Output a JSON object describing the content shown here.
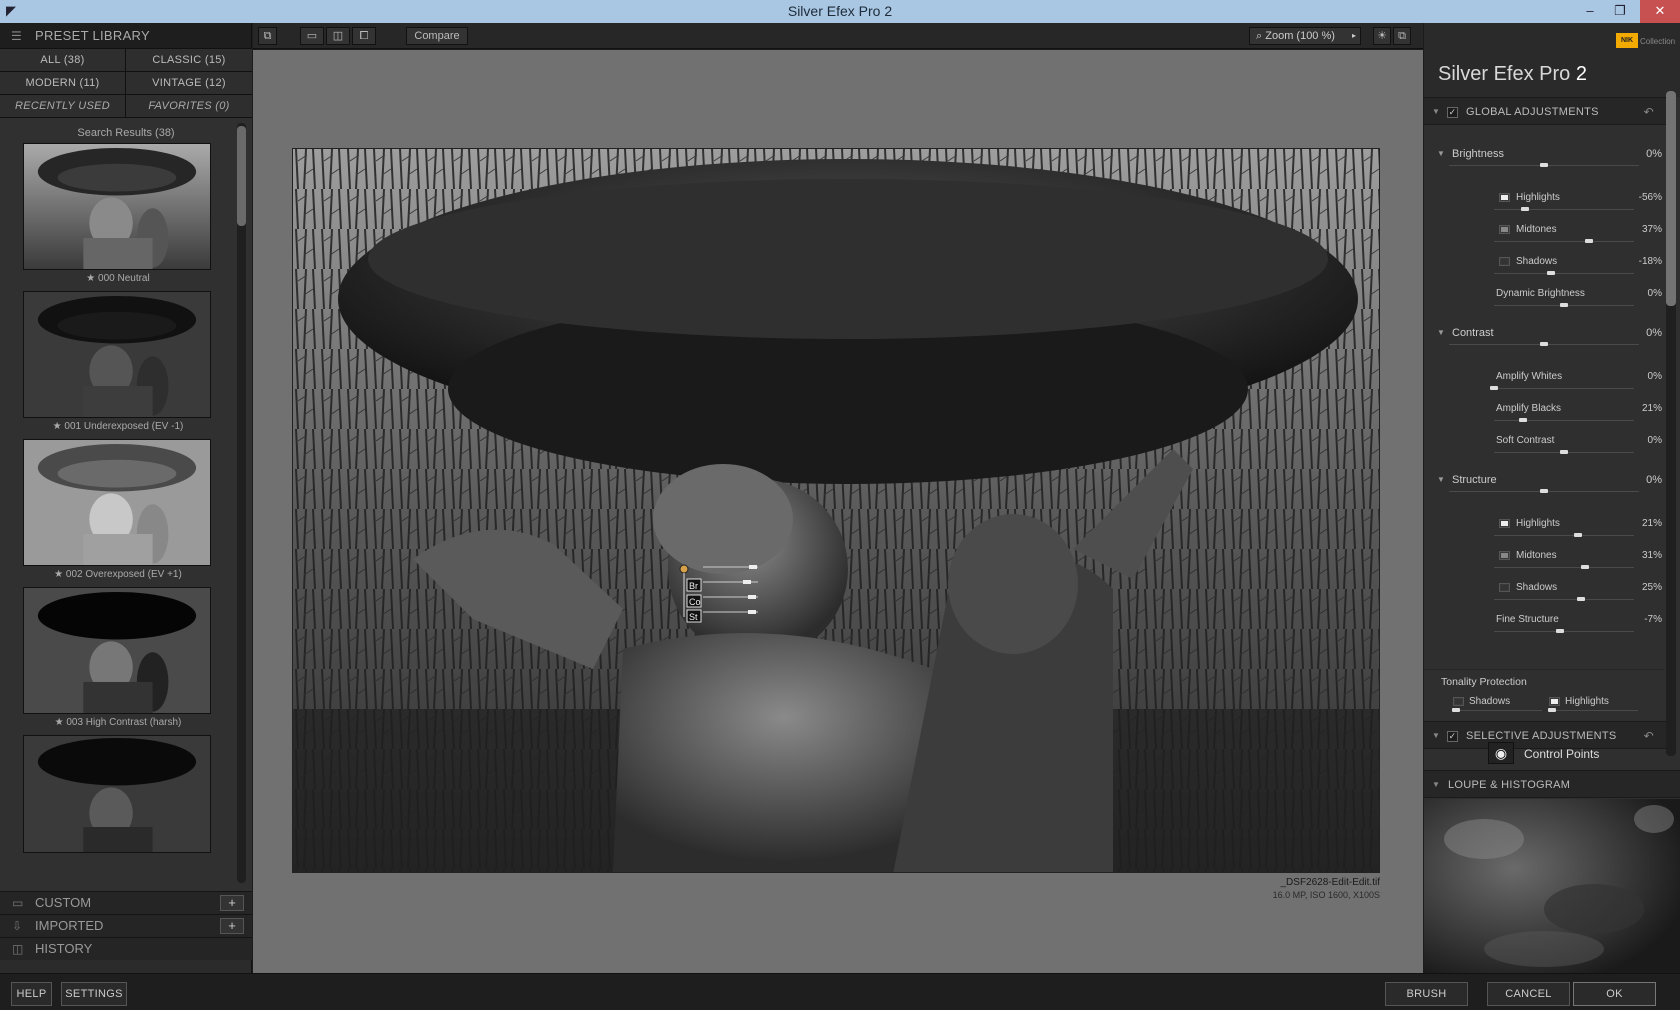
{
  "window": {
    "title": "Silver Efex Pro 2",
    "minimize": "–",
    "restore": "❐",
    "close": "✕"
  },
  "library": {
    "title": "PRESET LIBRARY",
    "categories": [
      "ALL (38)",
      "CLASSIC (15)",
      "MODERN (11)",
      "VINTAGE (12)",
      "RECENTLY USED",
      "FAVORITES (0)"
    ],
    "results_title": "Search Results (38)",
    "presets": [
      "★ 000 Neutral",
      "★ 001 Underexposed (EV -1)",
      "★ 002 Overexposed (EV +1)",
      "★ 003 High Contrast (harsh)"
    ],
    "footer": [
      {
        "label": "CUSTOM",
        "plus": "+"
      },
      {
        "label": "IMPORTED",
        "plus": "+"
      },
      {
        "label": "HISTORY"
      }
    ]
  },
  "toolbar": {
    "compare": "Compare",
    "zoom": "Zoom (100 %)"
  },
  "image": {
    "filename": "_DSF2628-Edit-Edit.tif",
    "meta": "16.0 MP, ISO 1600, X100S",
    "cp_labels": [
      "Br",
      "Co",
      "St"
    ]
  },
  "panel": {
    "brand_name": "Silver Efex Pro",
    "brand_num": "2",
    "nik": "NIK",
    "collection": "Collection",
    "global": "GLOBAL ADJUSTMENTS",
    "brightness": {
      "label": "Brightness",
      "value": "0%",
      "pos": 0.5
    },
    "b_highlights": {
      "label": "Highlights",
      "value": "-56%",
      "pos": 0.22
    },
    "b_midtones": {
      "label": "Midtones",
      "value": "37%",
      "pos": 0.68
    },
    "b_shadows": {
      "label": "Shadows",
      "value": "-18%",
      "pos": 0.41
    },
    "dynamic_brightness": {
      "label": "Dynamic Brightness",
      "value": "0%",
      "pos": 0.5
    },
    "contrast": {
      "label": "Contrast",
      "value": "0%",
      "pos": 0.5
    },
    "amplify_whites": {
      "label": "Amplify Whites",
      "value": "0%",
      "pos": 0.0
    },
    "amplify_blacks": {
      "label": "Amplify Blacks",
      "value": "21%",
      "pos": 0.21
    },
    "soft_contrast": {
      "label": "Soft Contrast",
      "value": "0%",
      "pos": 0.5
    },
    "structure": {
      "label": "Structure",
      "value": "0%",
      "pos": 0.5
    },
    "s_highlights": {
      "label": "Highlights",
      "value": "21%",
      "pos": 0.6
    },
    "s_midtones": {
      "label": "Midtones",
      "value": "31%",
      "pos": 0.65
    },
    "s_shadows": {
      "label": "Shadows",
      "value": "25%",
      "pos": 0.62
    },
    "fine_structure": {
      "label": "Fine Structure",
      "value": "-7%",
      "pos": 0.47
    },
    "tonality": "Tonality Protection",
    "tp_shadows": "Shadows",
    "tp_highlights": "Highlights",
    "selective": "SELECTIVE ADJUSTMENTS",
    "control_points": "Control Points",
    "loupe": "LOUPE & HISTOGRAM"
  },
  "bottom": {
    "help": "HELP",
    "settings": "SETTINGS",
    "brush": "BRUSH",
    "cancel": "CANCEL",
    "ok": "OK"
  }
}
